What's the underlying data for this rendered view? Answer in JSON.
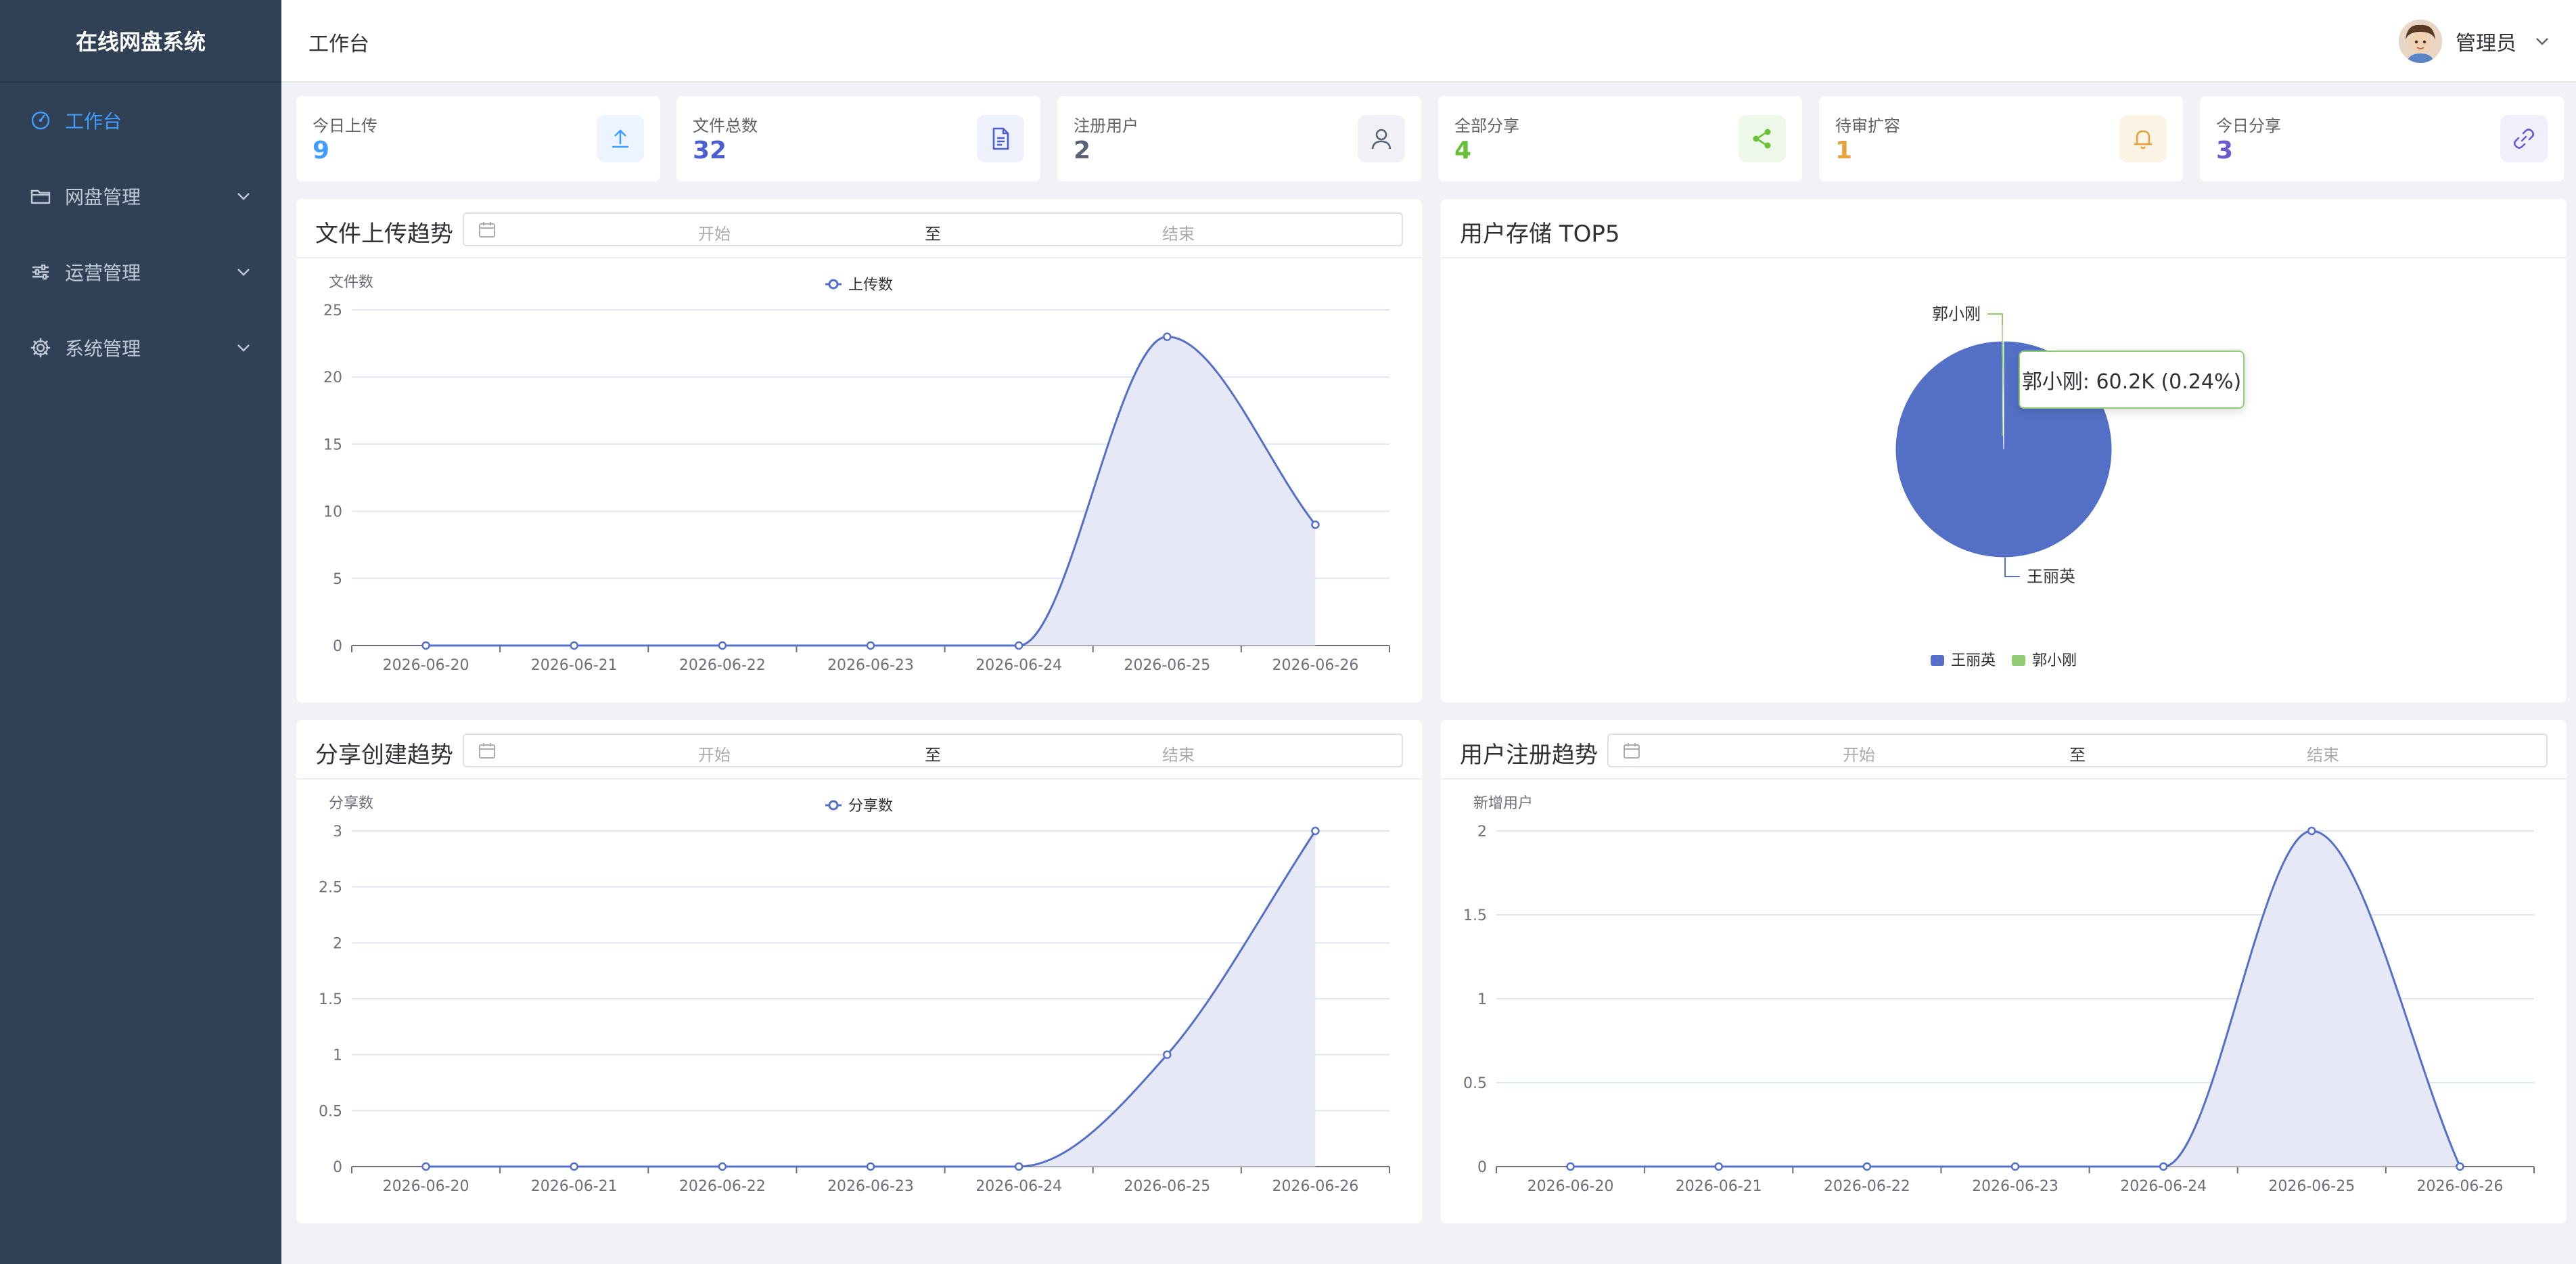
{
  "app": {
    "title": "在线网盘系统"
  },
  "sidebar": {
    "items": [
      {
        "label": "工作台",
        "icon": "dashboard-icon",
        "active": true
      },
      {
        "label": "网盘管理",
        "icon": "folder-icon",
        "expandable": true
      },
      {
        "label": "运营管理",
        "icon": "sliders-icon",
        "expandable": true
      },
      {
        "label": "系统管理",
        "icon": "gear-icon",
        "expandable": true
      }
    ]
  },
  "header": {
    "title": "工作台",
    "user": "管理员"
  },
  "stats": [
    {
      "label": "今日上传",
      "value": "9",
      "icon": "upload-icon",
      "color": "#409eff",
      "bg": "#ecf5ff"
    },
    {
      "label": "文件总数",
      "value": "32",
      "icon": "document-icon",
      "color": "#4c5fd0",
      "bg": "#eef0fb"
    },
    {
      "label": "注册用户",
      "value": "2",
      "icon": "user-icon",
      "color": "#5a6278",
      "bg": "#f0f1f4"
    },
    {
      "label": "全部分享",
      "value": "4",
      "icon": "share-icon",
      "color": "#67c23a",
      "bg": "#eef8e8"
    },
    {
      "label": "待审扩容",
      "value": "1",
      "icon": "bell-icon",
      "color": "#e6a23c",
      "bg": "#fdf4e6"
    },
    {
      "label": "今日分享",
      "value": "3",
      "icon": "link-icon",
      "color": "#6a5acd",
      "bg": "#f1effb"
    }
  ],
  "date_range": {
    "start_placeholder": "开始",
    "separator": "至",
    "end_placeholder": "结束"
  },
  "panels": {
    "upload_trend": {
      "title": "文件上传趋势"
    },
    "storage_top5": {
      "title": "用户存储 TOP5",
      "tooltip": "郭小刚: 60.2K (0.24%)"
    },
    "share_trend": {
      "title": "分享创建趋势"
    },
    "register_trend": {
      "title": "用户注册趋势"
    }
  },
  "colors": {
    "primary": "#5470c6",
    "area": "#e3e6f4",
    "green": "#91cc75",
    "sidebar": "#304156",
    "active": "#409eff"
  },
  "chart_data": [
    {
      "type": "area",
      "categories": [
        "2026-06-20",
        "2026-06-21",
        "2026-06-22",
        "2026-06-23",
        "2026-06-24",
        "2026-06-25",
        "2026-06-26"
      ],
      "series": [
        {
          "name": "上传数",
          "values": [
            0,
            0,
            0,
            0,
            0,
            23,
            9
          ]
        }
      ],
      "ylabel": "文件数",
      "ylim": [
        0,
        25
      ],
      "yticks": [
        0,
        5,
        10,
        15,
        20,
        25
      ],
      "legend": "top-center",
      "grid": true,
      "smooth": true
    },
    {
      "type": "pie",
      "categories": [
        "王丽英",
        "郭小刚"
      ],
      "values": [
        99.76,
        0.24
      ],
      "legend": "bottom-center",
      "colors": [
        "#5470c6",
        "#91cc75"
      ]
    },
    {
      "type": "area",
      "categories": [
        "2026-06-20",
        "2026-06-21",
        "2026-06-22",
        "2026-06-23",
        "2026-06-24",
        "2026-06-25",
        "2026-06-26"
      ],
      "series": [
        {
          "name": "分享数",
          "values": [
            0,
            0,
            0,
            0,
            0,
            1,
            3
          ]
        }
      ],
      "ylabel": "分享数",
      "ylim": [
        0,
        3
      ],
      "yticks": [
        0,
        0.5,
        1,
        1.5,
        2,
        2.5,
        3
      ],
      "legend": "top-center",
      "grid": true,
      "smooth": true
    },
    {
      "type": "area",
      "categories": [
        "2026-06-20",
        "2026-06-21",
        "2026-06-22",
        "2026-06-23",
        "2026-06-24",
        "2026-06-25",
        "2026-06-26"
      ],
      "series": [
        {
          "values": [
            0,
            0,
            0,
            0,
            0,
            2,
            0
          ]
        }
      ],
      "ylabel": "新增用户",
      "ylim": [
        0,
        2
      ],
      "yticks": [
        0,
        0.5,
        1,
        1.5,
        2
      ],
      "grid": true,
      "smooth": true
    }
  ]
}
